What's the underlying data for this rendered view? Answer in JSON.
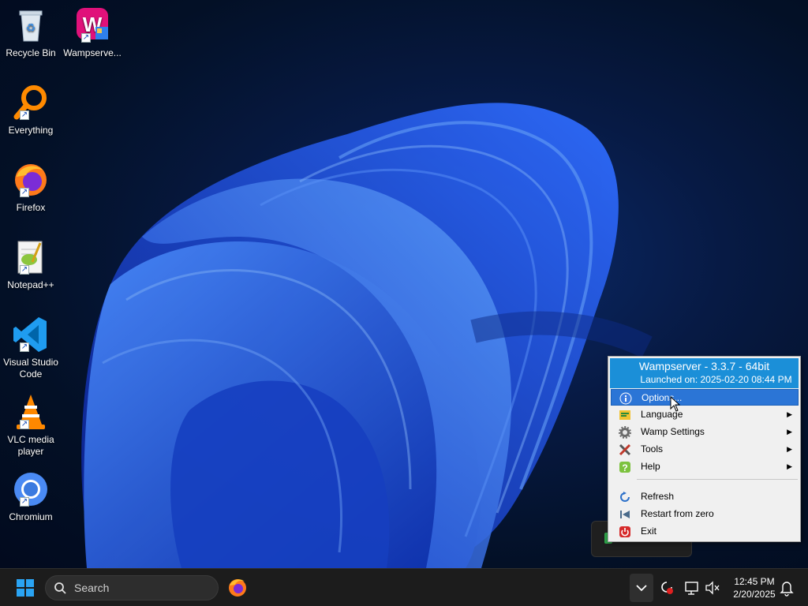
{
  "desktop": {
    "icons": [
      {
        "label": "Recycle Bin",
        "icon": "recycle-bin-icon"
      },
      {
        "label": "Wampserve...",
        "icon": "wampserver-icon"
      },
      {
        "label": "Everything",
        "icon": "everything-search-icon"
      },
      {
        "label": "Firefox",
        "icon": "firefox-icon"
      },
      {
        "label": "Notepad++",
        "icon": "notepad-plus-plus-icon"
      },
      {
        "label": "Visual Studio Code",
        "icon": "vscode-icon"
      },
      {
        "label": "VLC media player",
        "icon": "vlc-icon"
      },
      {
        "label": "Chromium",
        "icon": "chromium-icon"
      }
    ]
  },
  "wamp_menu": {
    "title": "Wampserver - 3.3.7 - 64bit",
    "launched": "Launched on:  2025-02-20 08:44 PM",
    "items": [
      {
        "label": "Options...",
        "icon": "info-icon",
        "submenu": false,
        "highlighted": true
      },
      {
        "label": "Language",
        "icon": "language-icon",
        "submenu": true
      },
      {
        "label": "Wamp Settings",
        "icon": "gear-icon",
        "submenu": true
      },
      {
        "label": "Tools",
        "icon": "tools-icon",
        "submenu": true
      },
      {
        "label": "Help",
        "icon": "help-icon",
        "submenu": true
      },
      {
        "label": "Refresh",
        "icon": "refresh-icon",
        "submenu": false
      },
      {
        "label": "Restart from zero",
        "icon": "restart-icon",
        "submenu": false
      },
      {
        "label": "Exit",
        "icon": "power-icon",
        "submenu": false
      }
    ],
    "submenu_arrow": "▶"
  },
  "taskbar": {
    "search_placeholder": "Search",
    "time": "12:45 PM",
    "date": "2/20/2025"
  },
  "colors": {
    "menu_header": "#1b8fd8",
    "menu_highlight": "#2b75d6",
    "taskbar": "#1c1c1c",
    "wallpaper_bloom": "#1f5cf0"
  }
}
